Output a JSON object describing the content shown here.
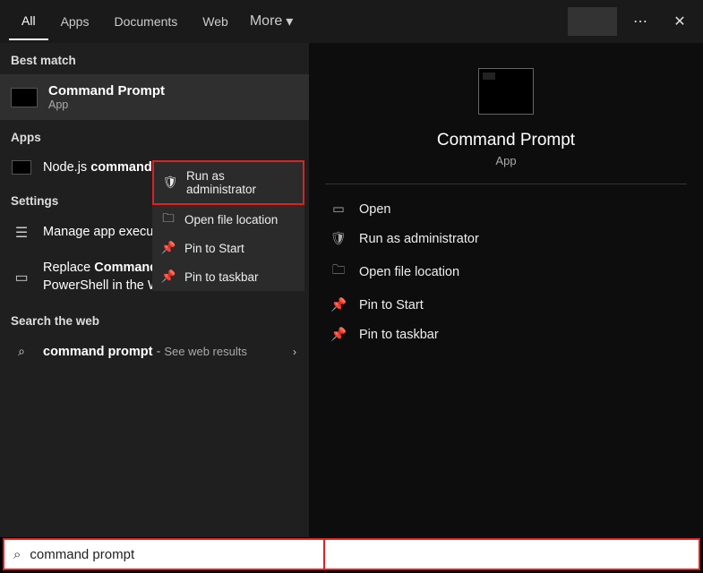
{
  "tabs": {
    "all": "All",
    "apps": "Apps",
    "documents": "Documents",
    "web": "Web",
    "more": "More"
  },
  "sections": {
    "best": "Best match",
    "apps": "Apps",
    "settings": "Settings",
    "web": "Search the web"
  },
  "best_match": {
    "title": "Command Prompt",
    "sub": "App"
  },
  "apps_list": {
    "node_pre": "Node.js ",
    "node_bold": "command prompt"
  },
  "settings_list": {
    "s1": "Manage app execution aliases",
    "s2_pre": "Replace ",
    "s2_bold": "Command Prompt",
    "s2_post": " with Windows PowerShell in the Win + X"
  },
  "web_list": {
    "q_bold": "command prompt",
    "q_post": " - ",
    "q_hint": "See web results"
  },
  "context_menu": {
    "run_admin": "Run as administrator",
    "open_loc": "Open file location",
    "pin_start": "Pin to Start",
    "pin_taskbar": "Pin to taskbar"
  },
  "preview": {
    "title": "Command Prompt",
    "sub": "App"
  },
  "actions": {
    "open": "Open",
    "run_admin": "Run as administrator",
    "open_loc": "Open file location",
    "pin_start": "Pin to Start",
    "pin_taskbar": "Pin to taskbar"
  },
  "search": {
    "value": "command prompt"
  }
}
